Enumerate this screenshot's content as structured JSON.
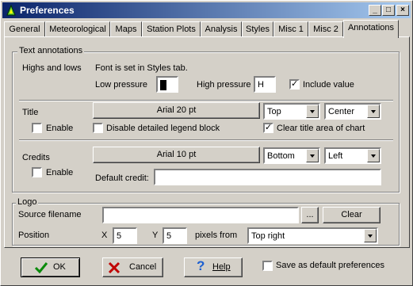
{
  "window": {
    "title": "Preferences",
    "min": "_",
    "max": "□",
    "close": "×"
  },
  "tabs": [
    "General",
    "Meteorological",
    "Maps",
    "Station Plots",
    "Analysis",
    "Styles",
    "Misc 1",
    "Misc 2",
    "Annotations"
  ],
  "text_annotations": {
    "legend": "Text annotations",
    "highs_lows_label": "Highs and lows",
    "font_note": "Font is set in Styles tab.",
    "low_pressure_label": "Low pressure",
    "low_pressure_value": "L",
    "high_pressure_label": "High pressure",
    "high_pressure_value": "H",
    "include_value_label": "Include value",
    "include_value_mark": "✓"
  },
  "title_row": {
    "label": "Title",
    "font_button": "Arial 20 pt",
    "position": "Top",
    "align": "Center",
    "enable_label": "Enable",
    "disable_legend_label": "Disable detailed legend block",
    "clear_title_label": "Clear title area of chart",
    "clear_title_mark": "✓"
  },
  "credits_row": {
    "label": "Credits",
    "font_button": "Arial 10 pt",
    "position": "Bottom",
    "align": "Left",
    "enable_label": "Enable",
    "default_credit_label": "Default credit:",
    "default_credit_value": ""
  },
  "logo": {
    "legend": "Logo",
    "source_label": "Source filename",
    "source_value": "",
    "browse_label": "...",
    "clear_label": "Clear",
    "position_label": "Position",
    "x_label": "X",
    "x_value": "5",
    "y_label": "Y",
    "y_value": "5",
    "pixels_from_label": "pixels from",
    "anchor_value": "Top right"
  },
  "footer": {
    "ok_label": "OK",
    "cancel_label": "Cancel",
    "help_label": "Help",
    "save_default_label": "Save as default preferences"
  }
}
